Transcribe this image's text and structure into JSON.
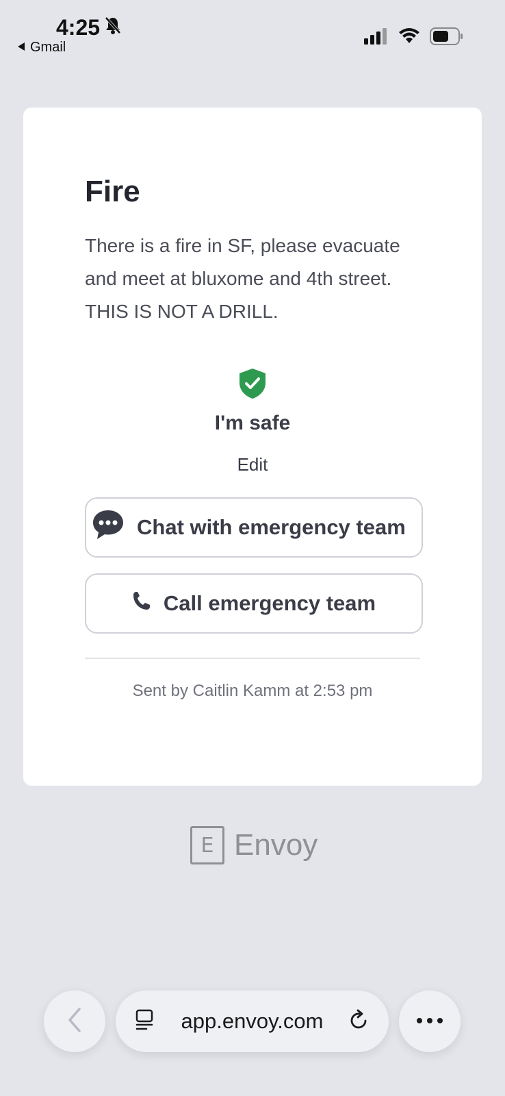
{
  "status_bar": {
    "time": "4:25",
    "back_app": "Gmail",
    "icons": [
      "bell-slash-icon",
      "signal-icon",
      "wifi-icon",
      "battery-icon"
    ]
  },
  "alert": {
    "title": "Fire",
    "message": "There is a fire in SF, please evacuate and meet at bluxome and 4th street. THIS IS NOT A DRILL.",
    "status_label": "I'm safe",
    "edit_label": "Edit",
    "chat_button": "Chat with emergency team",
    "call_button": "Call emergency team",
    "sent_by": "Sent by Caitlin Kamm at 2:53 pm"
  },
  "brand": {
    "mark": "E",
    "name": "Envoy"
  },
  "browser": {
    "url": "app.envoy.com"
  },
  "colors": {
    "background": "#e3e5ea",
    "card": "#ffffff",
    "safe_green": "#2e9a4f",
    "text_dark": "#23252f"
  }
}
